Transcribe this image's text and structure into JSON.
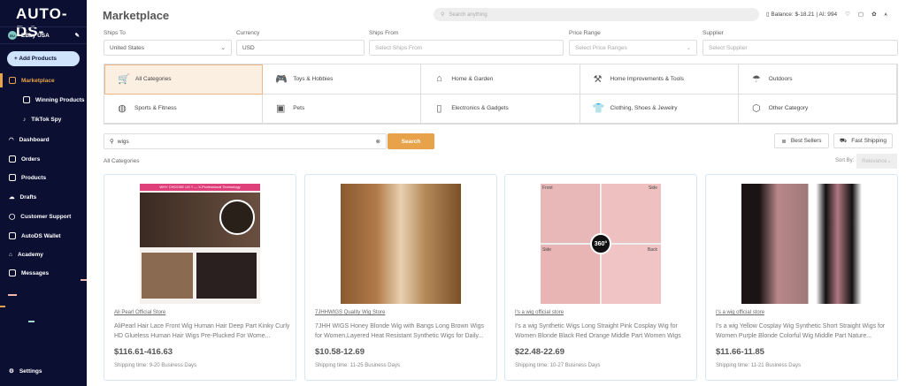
{
  "sidebar": {
    "logo": "AUTO-DS-",
    "account": "EBay USA",
    "account_initials": "EU",
    "add_products": "+ Add Products",
    "items": [
      {
        "label": "Marketplace",
        "active": true
      },
      {
        "label": "Winning Products",
        "sub": true
      },
      {
        "label": "TikTok Spy",
        "sub": true
      },
      {
        "label": "Dashboard"
      },
      {
        "label": "Orders"
      },
      {
        "label": "Products"
      },
      {
        "label": "Drafts"
      },
      {
        "label": "Customer Support"
      },
      {
        "label": "AutoDS Wallet"
      },
      {
        "label": "Academy"
      },
      {
        "label": "Messages"
      }
    ],
    "settings": "Settings"
  },
  "header": {
    "title": "Marketplace",
    "search_placeholder": "Search anything",
    "balance": "Balance: $-18.21 | AI: 994"
  },
  "filters": [
    {
      "label": "Ships To",
      "value": "United States"
    },
    {
      "label": "Currency",
      "value": "USD"
    },
    {
      "label": "Ships From",
      "placeholder": "Select Ships From"
    },
    {
      "label": "Price Range",
      "placeholder": "Select Price Ranges"
    },
    {
      "label": "Supplier",
      "placeholder": "Select Supplier"
    }
  ],
  "categories": [
    {
      "label": "All Categories",
      "icon": "🛒"
    },
    {
      "label": "Toys & Hobbies",
      "icon": "🎮"
    },
    {
      "label": "Home & Garden",
      "icon": "⌂"
    },
    {
      "label": "Home Improvements & Tools",
      "icon": "⚒"
    },
    {
      "label": "Outdoors",
      "icon": "☂"
    },
    {
      "label": "Sports & Fitness",
      "icon": "◍"
    },
    {
      "label": "Pets",
      "icon": "▣"
    },
    {
      "label": "Electronics & Gadgets",
      "icon": "▯"
    },
    {
      "label": "Clothing, Shoes & Jewelry",
      "icon": "👕"
    },
    {
      "label": "Other Category",
      "icon": "⬡"
    }
  ],
  "search": {
    "value": "wigs",
    "button": "Search"
  },
  "toolbar": {
    "best_sellers": "Best Sellers",
    "fast_shipping": "Fast Shipping",
    "breadcrumb": "All Categories",
    "sort_label": "Sort By:",
    "sort_value": "Relevance"
  },
  "products": [
    {
      "store": "Ali Pearl Official Store",
      "title": "AliPearl Hair Lace Front Wig Human Hair Deep Part Kinky Curly HD Glueless Human Hair Wigs Pre-Plucked For Wome...",
      "price": "$116.61-416.63",
      "shipping": "Shipping time: 9-20 Business Days",
      "image_banner": "WHY CHOOSE US ? — X-Professional Technology"
    },
    {
      "store": "7JHHWIGS Quality Wig Store",
      "title": "7JHH WIGS Honey Blonde Wig with Bangs Long Brown Wigs for Women,Layered Heat Resistant Synthetic Wigs for Daily...",
      "price": "$10.58-12.69",
      "shipping": "Shipping time: 11-25 Business Days"
    },
    {
      "store": "I's a wig official store",
      "title": "I's a wig Synthetic Wigs Long Straight Pink Cosplay Wig for Women Blonde Black Red Orange Middle Part Women Wigs",
      "price": "$22.48-22.69",
      "shipping": "Shipping time: 10-27 Business Days",
      "image_labels": [
        "Front",
        "Side",
        "Side",
        "Back",
        "360°"
      ]
    },
    {
      "store": "I's a wig official store",
      "title": "I's a wig Yellow Cosplay Wig Synthetic Short Straight Wigs for Women Purple Blonde Colorful Wig Middle Part Nature...",
      "price": "$11.66-11.85",
      "shipping": "Shipping time: 11-21 Business Days"
    }
  ],
  "colors": {
    "sidebar": "#0b1033",
    "accent": "#e8a24a",
    "selected_category": "#fbefe2"
  }
}
